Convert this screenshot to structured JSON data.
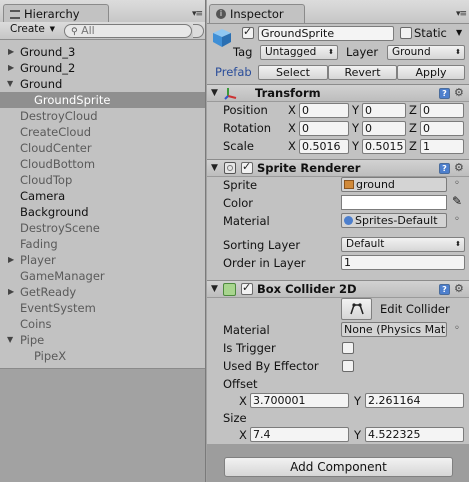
{
  "hierarchy": {
    "tab_label": "Hierarchy",
    "create_label": "Create",
    "search_placeholder": "All",
    "items": [
      {
        "label": "Ground_3"
      },
      {
        "label": "Ground_2"
      },
      {
        "label": "Ground"
      },
      {
        "label": "GroundSprite"
      },
      {
        "label": "DestroyCloud"
      },
      {
        "label": "CreateCloud"
      },
      {
        "label": "CloudCenter"
      },
      {
        "label": "CloudBottom"
      },
      {
        "label": "CloudTop"
      },
      {
        "label": "Camera"
      },
      {
        "label": "Background"
      },
      {
        "label": "DestroyScene"
      },
      {
        "label": "Fading"
      },
      {
        "label": "Player"
      },
      {
        "label": "GameManager"
      },
      {
        "label": "GetReady"
      },
      {
        "label": "EventSystem"
      },
      {
        "label": "Coins"
      },
      {
        "label": "Pipe"
      },
      {
        "label": "PipeX"
      }
    ]
  },
  "inspector": {
    "tab_label": "Inspector",
    "object_name": "GroundSprite",
    "static_label": "Static",
    "tag_label": "Tag",
    "tag_value": "Untagged",
    "layer_label": "Layer",
    "layer_value": "Ground",
    "prefab_label": "Prefab",
    "select_label": "Select",
    "revert_label": "Revert",
    "apply_label": "Apply",
    "transform": {
      "title": "Transform",
      "position_label": "Position",
      "rotation_label": "Rotation",
      "scale_label": "Scale",
      "x_label": "X",
      "y_label": "Y",
      "z_label": "Z",
      "position": {
        "x": "0",
        "y": "0",
        "z": "0"
      },
      "rotation": {
        "x": "0",
        "y": "0",
        "z": "0"
      },
      "scale": {
        "x": "0.5016",
        "y": "0.5015",
        "z": "1"
      }
    },
    "sprite_renderer": {
      "title": "Sprite Renderer",
      "sprite_label": "Sprite",
      "sprite_value": "ground",
      "color_label": "Color",
      "material_label": "Material",
      "material_value": "Sprites-Default",
      "sorting_layer_label": "Sorting Layer",
      "sorting_layer_value": "Default",
      "order_label": "Order in Layer",
      "order_value": "1"
    },
    "box_collider": {
      "title": "Box Collider 2D",
      "edit_label": "Edit Collider",
      "material_label": "Material",
      "material_value": "None (Physics Mat",
      "is_trigger_label": "Is Trigger",
      "used_by_effector_label": "Used By Effector",
      "offset_label": "Offset",
      "offset": {
        "x": "3.700001",
        "y": "2.261164"
      },
      "size_label": "Size",
      "size": {
        "x": "7.4",
        "y": "4.522325"
      },
      "x_label": "X",
      "y_label": "Y"
    },
    "add_component_label": "Add Component"
  },
  "colors": {
    "panel_bg": "#c2c2c2",
    "selection_bg": "#8f8f8f",
    "accent_blue": "#4d7fcd"
  }
}
